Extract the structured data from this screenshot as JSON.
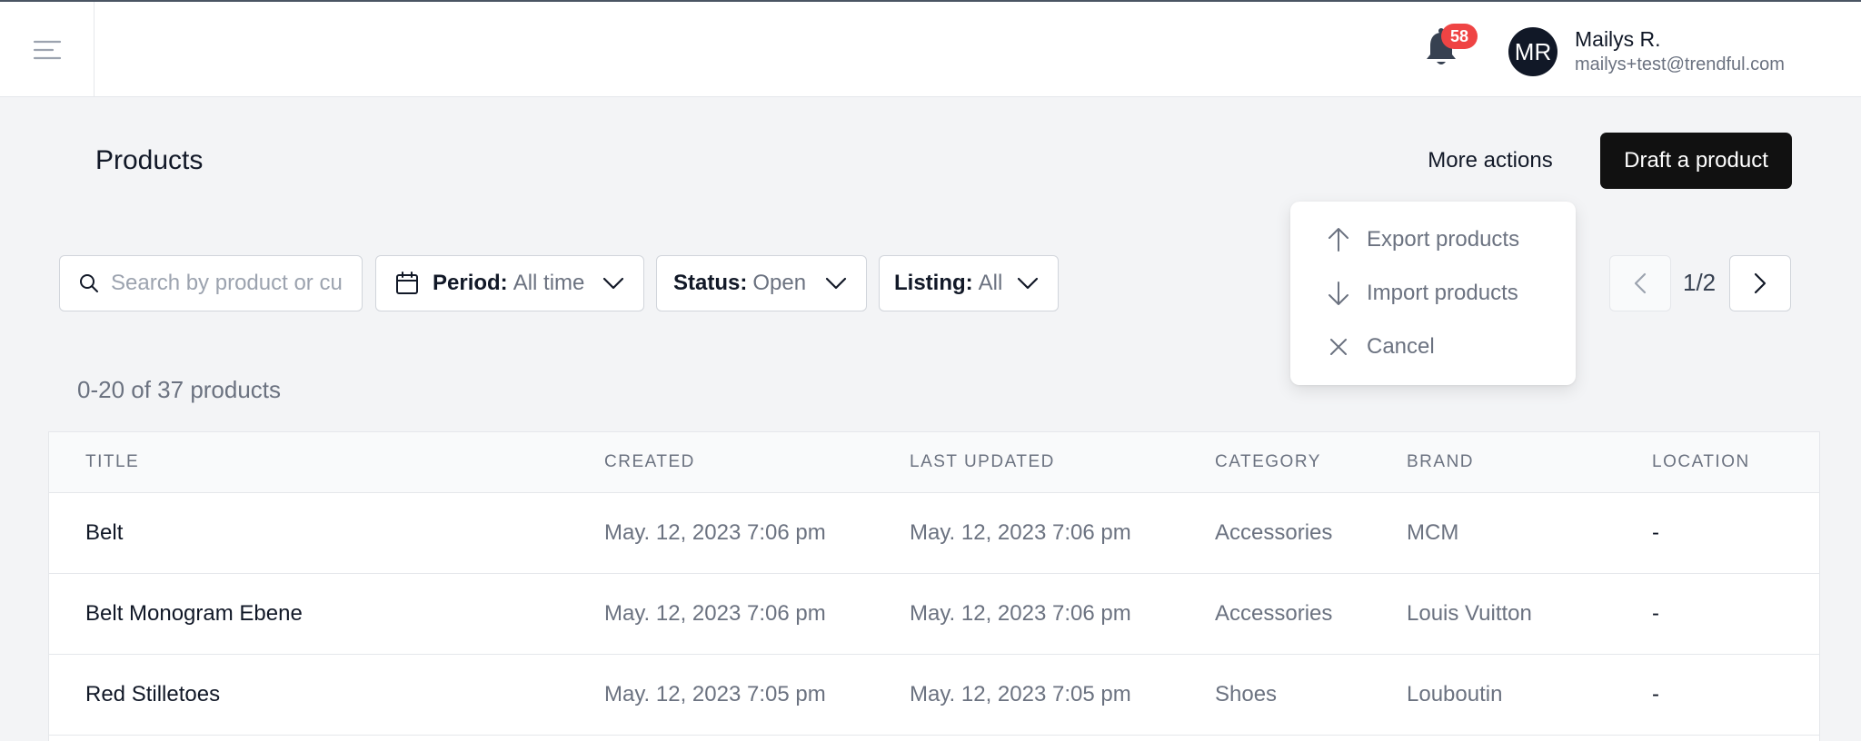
{
  "header": {
    "notifications_count": "58",
    "user": {
      "initials": "MR",
      "name": "Mailys R.",
      "email": "mailys+test@trendful.com"
    }
  },
  "page": {
    "title": "Products",
    "more_actions_label": "More actions",
    "draft_button_label": "Draft a product"
  },
  "filters": {
    "search_placeholder": "Search by product or cu",
    "period": {
      "label": "Period:",
      "value": "All time"
    },
    "status": {
      "label": "Status:",
      "value": "Open"
    },
    "listing": {
      "label": "Listing:",
      "value": "All"
    }
  },
  "pagination": {
    "text": "1/2"
  },
  "more_actions_menu": {
    "items": [
      {
        "label": "Export products",
        "icon": "arrow-up-icon"
      },
      {
        "label": "Import products",
        "icon": "arrow-down-icon"
      },
      {
        "label": "Cancel",
        "icon": "close-icon"
      }
    ]
  },
  "results_count": "0-20 of 37 products",
  "table": {
    "columns": [
      "TITLE",
      "CREATED",
      "LAST UPDATED",
      "CATEGORY",
      "BRAND",
      "LOCATION"
    ],
    "rows": [
      {
        "title": "Belt",
        "created": "May. 12, 2023 7:06 pm",
        "updated": "May. 12, 2023 7:06 pm",
        "category": "Accessories",
        "brand": "MCM",
        "location": "-"
      },
      {
        "title": "Belt Monogram Ebene",
        "created": "May. 12, 2023 7:06 pm",
        "updated": "May. 12, 2023 7:06 pm",
        "category": "Accessories",
        "brand": "Louis Vuitton",
        "location": "-"
      },
      {
        "title": "Red Stilletoes",
        "created": "May. 12, 2023 7:05 pm",
        "updated": "May. 12, 2023 7:05 pm",
        "category": "Shoes",
        "brand": "Louboutin",
        "location": "-"
      }
    ]
  },
  "colors": {
    "primary_button": "#111111",
    "badge": "#ef4444",
    "background": "#f3f4f6"
  }
}
